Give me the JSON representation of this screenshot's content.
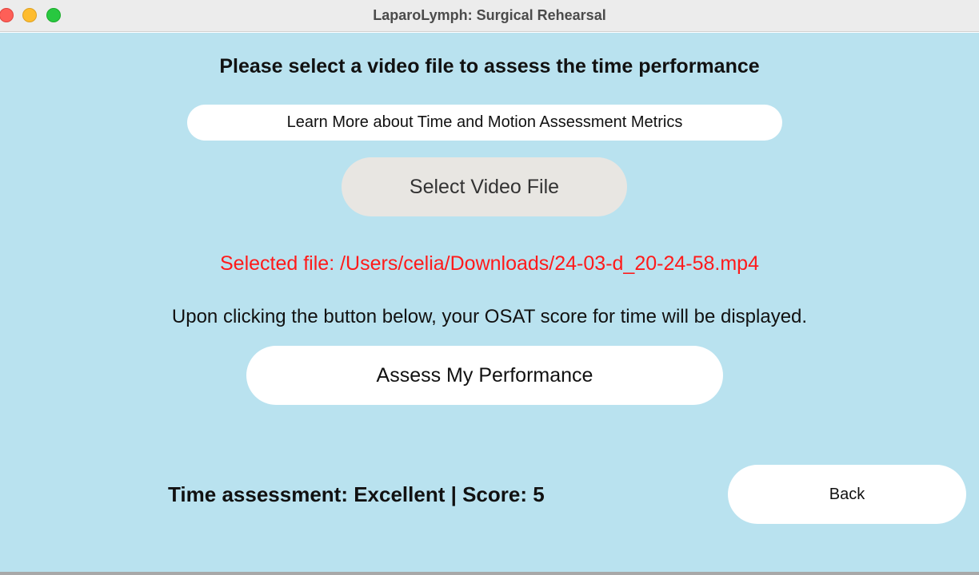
{
  "window": {
    "title": "LaparoLymph: Surgical Rehearsal"
  },
  "main": {
    "heading": "Please select a video file to assess the time performance",
    "learn_more_label": "Learn More about Time and Motion Assessment Metrics",
    "select_video_label": "Select Video File",
    "selected_file_text": "Selected file: /Users/celia/Downloads/24-03-d_20-24-58.mp4",
    "instruction_text": "Upon clicking the button below, your OSAT score for time will be displayed.",
    "assess_label": "Assess My Performance",
    "result_text": "Time assessment: Excellent | Score: 5",
    "back_label": "Back"
  },
  "colors": {
    "background": "#b9e2ef",
    "selected_file_text": "#ff1a1a",
    "select_button": "#e8e6e2",
    "button": "#ffffff"
  }
}
